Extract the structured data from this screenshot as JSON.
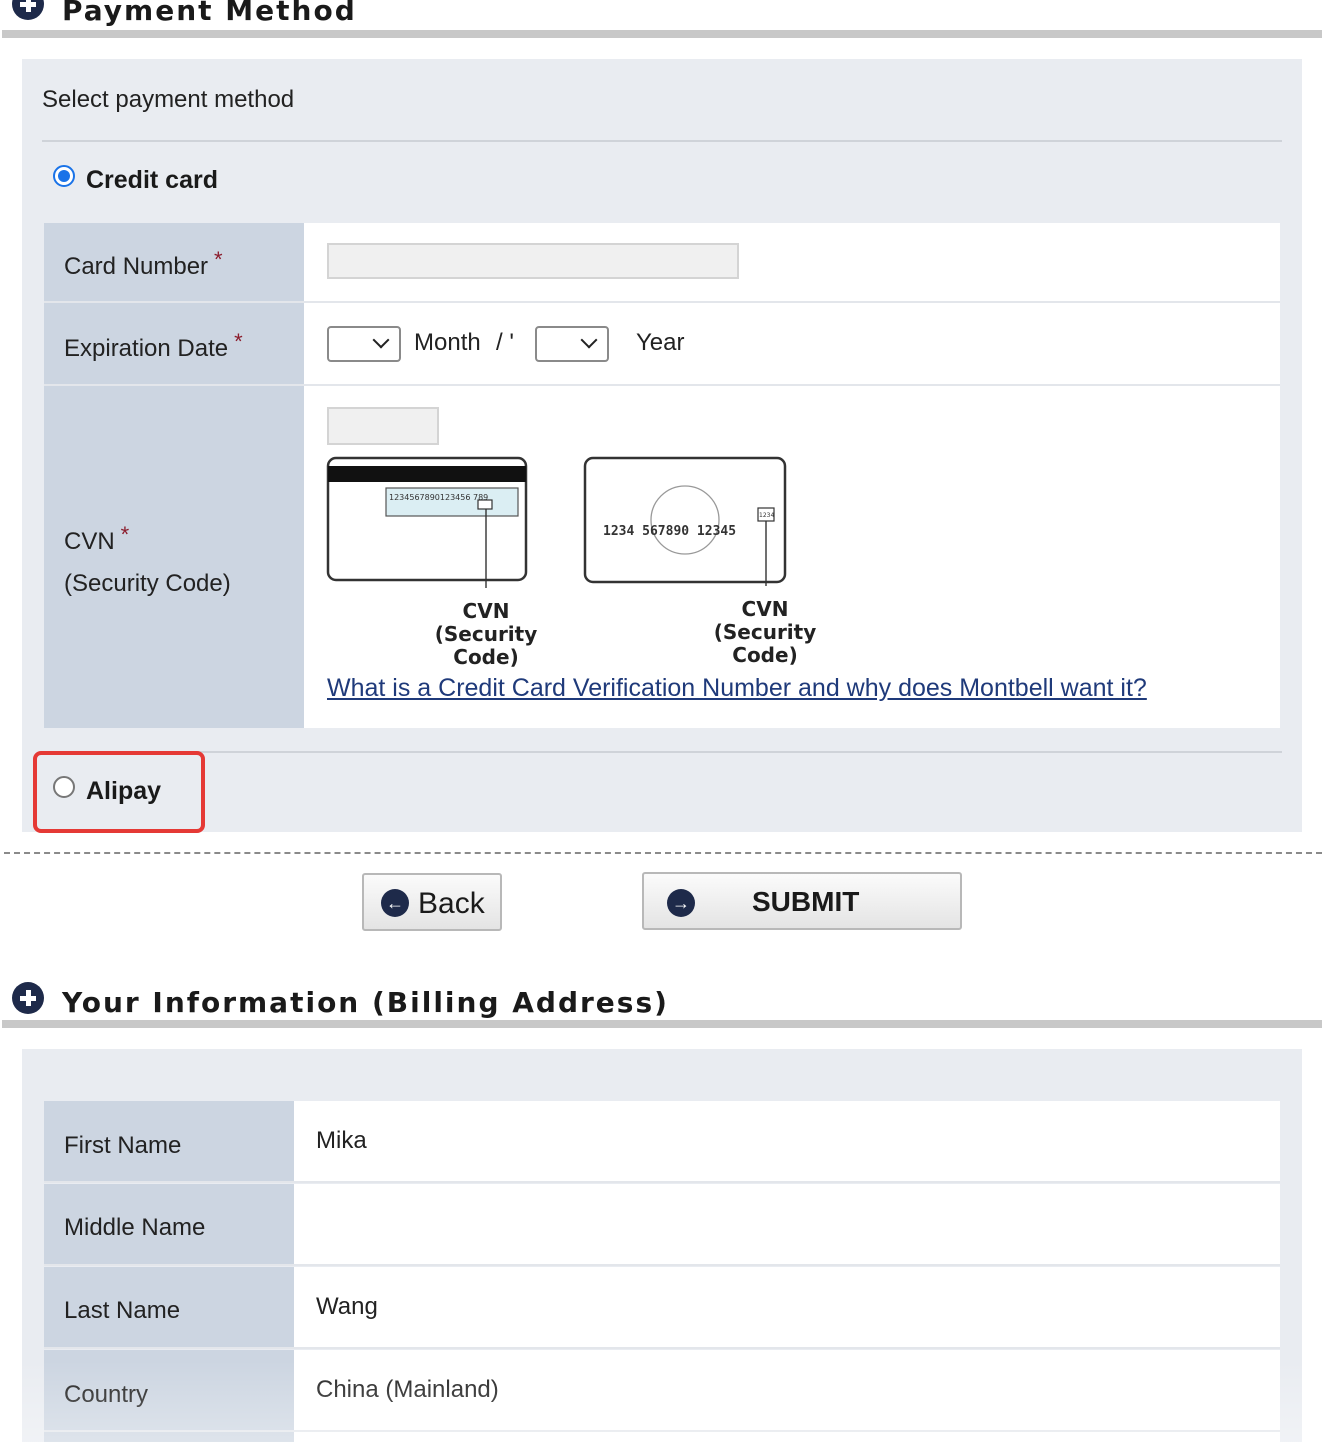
{
  "payment_section": {
    "title": "Payment Method",
    "intro": "Select payment method",
    "options": {
      "credit_card": {
        "label": "Credit card",
        "selected": true
      },
      "alipay": {
        "label": "Alipay",
        "selected": false
      }
    },
    "fields": {
      "card_number": {
        "label": "Card Number",
        "required_mark": "*",
        "value": ""
      },
      "expiration": {
        "label": "Expiration Date",
        "required_mark": "*",
        "month_value": "",
        "month_label": "Month",
        "separator": "/ '",
        "year_value": "",
        "year_label": "Year"
      },
      "cvn": {
        "label": "CVN",
        "required_mark": "*",
        "sublabel": "(Security Code)",
        "value": ""
      }
    },
    "card_back_illustration": {
      "strip_digits": "1234567890123456 789",
      "caption_line1": "CVN",
      "caption_line2": "(Security Code)"
    },
    "card_front_illustration": {
      "digits": "1234  567890  12345",
      "code_digits": "1234",
      "caption_line1": "CVN",
      "caption_line2": "(Security Code)"
    },
    "cvn_help_link": "What is a Credit Card Verification Number and why does Montbell want it?"
  },
  "buttons": {
    "back": "Back",
    "submit": "SUBMIT"
  },
  "billing_section": {
    "title": "Your Information (Billing Address)",
    "fields": [
      {
        "label": "First Name",
        "value": "Mika"
      },
      {
        "label": "Middle Name",
        "value": ""
      },
      {
        "label": "Last Name",
        "value": "Wang"
      },
      {
        "label": "Country",
        "value": "China (Mainland)"
      }
    ]
  },
  "colors": {
    "panel_bg": "#e9ecf1",
    "label_cell_bg": "#ccd5e1",
    "icon_navy": "#1e2a4a",
    "link_color": "#1f3a7a",
    "required_color": "#8b1c2c",
    "highlight_red": "#e53935",
    "radio_blue": "#1a73e8"
  }
}
